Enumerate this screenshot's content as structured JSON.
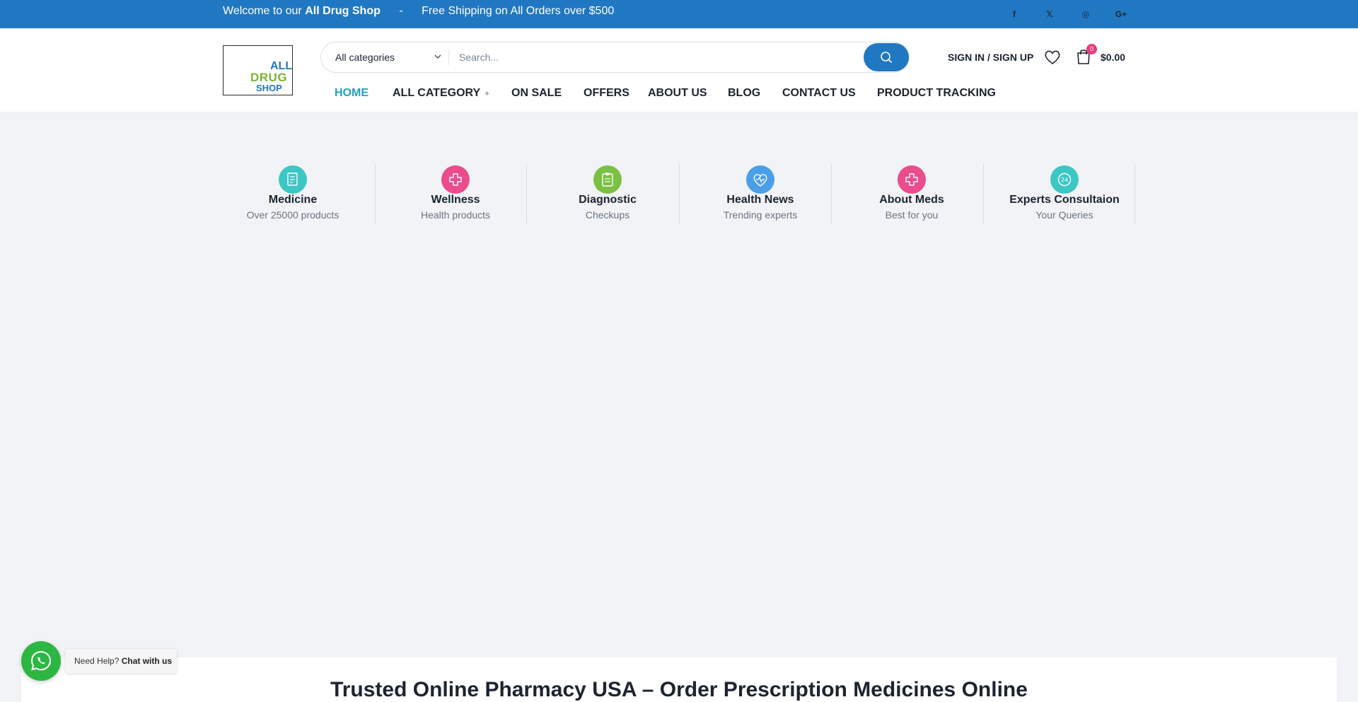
{
  "topbar": {
    "welcome_prefix": "Welcome to our",
    "welcome_brand": "All Drug Shop",
    "separator": "-",
    "shipping": "Free Shipping on All Orders over $500",
    "social": [
      {
        "icon": "facebook-icon",
        "glyph": "f"
      },
      {
        "icon": "x-twitter-icon",
        "glyph": "𝕏"
      },
      {
        "icon": "instagram-icon",
        "glyph": "◎"
      },
      {
        "icon": "google-plus-icon",
        "glyph": "G+"
      }
    ]
  },
  "header": {
    "logo": {
      "line1": "ALL",
      "line2": "DRUG",
      "line3": "SHOP"
    },
    "search": {
      "category_selected": "All categories",
      "placeholder": "Search..."
    },
    "signin_label": "SIGN IN / SIGN UP",
    "cart_count": "0",
    "cart_total": "$0.00"
  },
  "nav": {
    "items": [
      {
        "label": "HOME",
        "active": true
      },
      {
        "label": "ALL CATEGORY",
        "has_submenu": true
      },
      {
        "label": "ON SALE"
      },
      {
        "label": "OFFERS"
      },
      {
        "label": "ABOUT US"
      },
      {
        "label": "BLOG"
      },
      {
        "label": "CONTACT US"
      },
      {
        "label": "PRODUCT TRACKING"
      }
    ],
    "submenu_glyph": "+"
  },
  "features": [
    {
      "title": "Medicine",
      "subtitle": "Over 25000 products",
      "icon": "prescription-icon",
      "color": "#3cc7c4"
    },
    {
      "title": "Wellness",
      "subtitle": "Health products",
      "icon": "wellness-hand-icon",
      "color": "#ec4b8c"
    },
    {
      "title": "Diagnostic",
      "subtitle": "Checkups",
      "icon": "clipboard-icon",
      "color": "#7bc043"
    },
    {
      "title": "Health News",
      "subtitle": "Trending experts",
      "icon": "heart-pulse-icon",
      "color": "#4a9fe8"
    },
    {
      "title": "About Meds",
      "subtitle": "Best for you",
      "icon": "medicine-hand-icon",
      "color": "#ec4b8c"
    },
    {
      "title": "Experts Consultaion",
      "subtitle": "Your Queries",
      "icon": "consultation-icon",
      "color": "#3cc7c4"
    }
  ],
  "main": {
    "heading": "Trusted Online Pharmacy USA – Order Prescription Medicines Online"
  },
  "whatsapp": {
    "prefix": "Need Help?",
    "cta": "Chat with us"
  },
  "colors": {
    "brand_blue": "#2178c2",
    "accent_teal": "#24a1b7",
    "badge_pink": "#e93a7d",
    "whatsapp_green": "#2db742"
  }
}
